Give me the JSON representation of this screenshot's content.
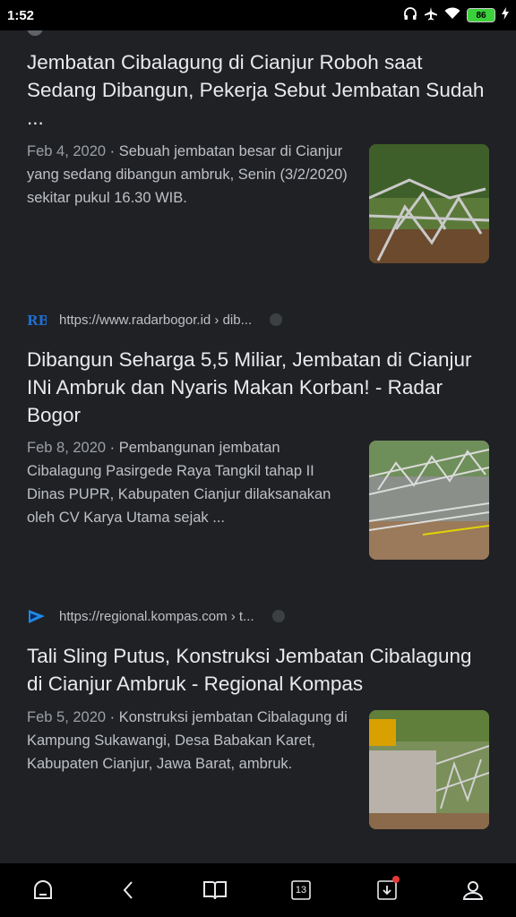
{
  "status_bar": {
    "time": "1:52",
    "battery": "86"
  },
  "results": [
    {
      "title": "Jembatan Cibalagung di Cianjur Roboh saat Sedang Dibangun, Pekerja Sebut Jembatan Sudah ...",
      "date": "Feb 4, 2020",
      "snippet": "Sebuah jembatan besar di Cianjur yang sedang dibangun ambruk, Senin (3/2/2020) sekitar pukul 16.30 WIB.",
      "thumbnail_icon": "collapsed-bridge-photo"
    },
    {
      "favicon_text": "RB",
      "url": "https://www.radarbogor.id › dib...",
      "title": "Dibangun Seharga 5,5 Miliar, Jembatan di Cianjur INi Ambruk dan Nyaris Makan Korban! - Radar Bogor",
      "date": "Feb 8, 2020",
      "snippet": "Pembangunan jembatan Cibalagung Pasirgede Raya Tangkil tahap II Dinas PUPR, Kabupaten Cianjur dilaksanakan oleh CV Karya Utama sejak ...",
      "thumbnail_icon": "collapsed-bridge-photo"
    },
    {
      "url": "https://regional.kompas.com › t...",
      "title": "Tali Sling Putus, Konstruksi Jembatan Cibalagung di Cianjur Ambruk - Regional Kompas",
      "date": "Feb 5, 2020",
      "snippet": "Konstruksi jembatan Cibalagung di Kampung Sukawangi, Desa Babakan Karet, Kabupaten Cianjur, Jawa Barat, ambruk.",
      "thumbnail_icon": "collapsed-bridge-photo"
    }
  ],
  "navbar": {
    "tab_count": "13"
  },
  "colors": {
    "background": "#202124",
    "text": "#e8eaed",
    "battery": "#3ad13a",
    "notification_dot": "#e53935"
  }
}
